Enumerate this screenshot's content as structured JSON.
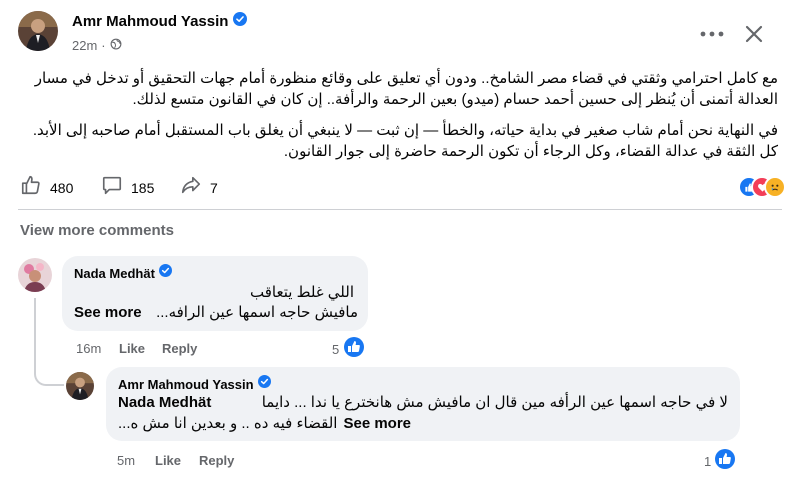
{
  "post": {
    "author": "Amr Mahmoud Yassin",
    "time": "22m",
    "paragraph1": "مع كامل احترامي وثقتي في قضاء مصر الشامخ.. ودون أي تعليق على وقائع منظورة أمام جهات التحقيق أو تدخل في مسار العدالة أتمنى أن يُنظر إلى حسين أحمد حسام (ميدو) بعين الرحمة والرأفة.. إن كان في القانون متسع لذلك.",
    "paragraph2": "في النهاية نحن أمام شاب صغير في بداية حياته، والخطأ — إن ثبت — لا ينبغي أن يغلق باب المستقبل أمام صاحبه إلى الأبد. كل الثقة في عدالة القضاء، وكل الرجاء أن تكون الرحمة حاضرة إلى جوار القانون.",
    "likes": "480",
    "comments": "185",
    "shares": "7",
    "view_more": "View more comments"
  },
  "comment1": {
    "author": "Nada Medhät",
    "line1": "اللي غلط يتعاقب",
    "line2": "مافيش حاجه اسمها عين الرافه...",
    "see_more": "See more",
    "time": "16m",
    "like": "Like",
    "reply": "Reply",
    "reaction_count": "5"
  },
  "reply1": {
    "author": "Amr Mahmoud Yassin",
    "mention": "Nada Medhät",
    "line1": "لا في حاجه اسمها عين الرأفه مين قال ان مافيش مش هانخترع يا ندا ... دايما",
    "line2": "القضاء فيه ده .. و بعدين انا مش ه...",
    "see_more": "See more",
    "time": "5m",
    "like": "Like",
    "reply": "Reply",
    "reaction_count": "1"
  },
  "colors": {
    "verified": "#1877f2",
    "like_blue": "#1877f2",
    "love_red": "#f33e58",
    "sad_yellow": "#f7b125"
  }
}
